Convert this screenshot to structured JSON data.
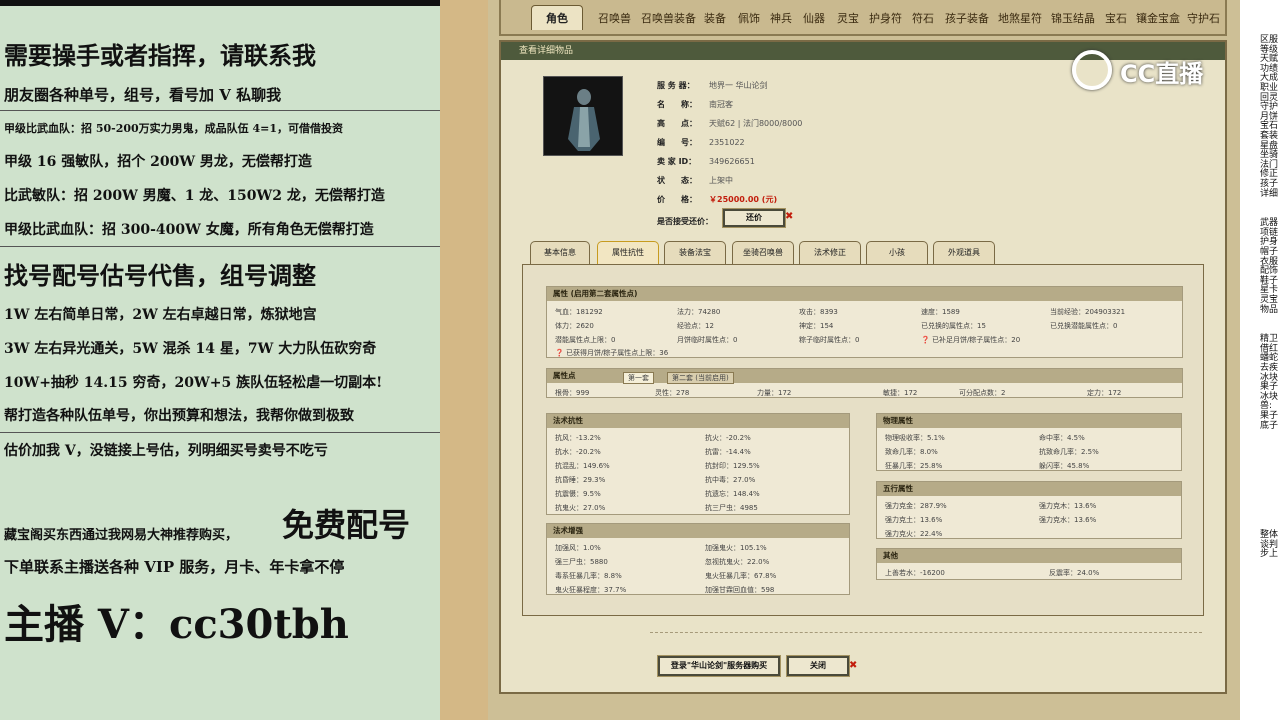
{
  "promo": {
    "l1": "需要操手或者指挥，请联系我",
    "l2": "朋友圈各种单号，组号，看号加 V 私聊我",
    "l3": "甲级比武血队：招 50-200万实力男鬼，成品队伍 4=1，可借借投资",
    "l4": "甲级 16 强敏队，招个 200W 男龙，无偿帮打造",
    "l5": "比武敏队：招 200W 男魔、1 龙、150W2 龙，无偿帮打造",
    "l6": "甲级比武血队：招 300-400W 女魔，所有角色无偿帮打造",
    "l7": "找号配号估号代售，组号调整",
    "l8": "1W 左右简单日常，2W 左右卓越日常，炼狱地宫",
    "l9": "3W 左右异光通关，5W 混杀 14 星，7W 大力队伍砍穷奇",
    "l10": "10W+抽秒 14.15 穷奇，20W+5 族队伍轻松虐一切副本!",
    "l11": "帮打造各种队伍单号，你出预算和想法，我帮你做到极致",
    "l12": "估价加我 V，没链接上号估，列明细买号卖号不吃亏",
    "l13a": "藏宝阁买东西通过我网易大神推荐购买，",
    "l13b": "免费配号",
    "l14": "下单联系主播送各种 VIP 服务，月卡、年卡拿不停",
    "l15": "主播 V：cc30tbh"
  },
  "tabs": [
    "角色",
    "召唤兽",
    "召唤兽装备",
    "装备",
    "佩饰",
    "神兵",
    "仙器",
    "灵宝",
    "护身符",
    "符石",
    "孩子装备",
    "地煞星符",
    "锦玉结晶",
    "宝石",
    "镶金宝盒",
    "守护石"
  ],
  "panel_title": "查看详细物品",
  "info": {
    "server_k": "服 务 器：",
    "server_v": "地界一 华山论剑",
    "name_k": "名　　称：",
    "name_v": "南冠客",
    "level_k": "高　　点：",
    "level_v": "天赋62 | 法门8000/8000",
    "id_k": "编　　号：",
    "id_v": "2351022",
    "seller_k": "卖 家 ID：",
    "seller_v": "349626651",
    "status_k": "状　　态：",
    "status_v": "上架中",
    "price_k": "价　　格：",
    "price_v": "￥25000.00 (元)",
    "bargain_k": "是否接受还价：",
    "bargain_btn": "还价"
  },
  "subtabs": [
    "基本信息",
    "属性抗性",
    "装备法宝",
    "坐骑召唤兽",
    "法术修正",
    "小孩",
    "外观道具"
  ],
  "attr": {
    "header": "属性 (启用第二套属性点)",
    "r1": [
      "气血：181292",
      "法力：74280",
      "攻击：8393",
      "速度：1589",
      "当前经验：204903321"
    ],
    "r2": [
      "体力：2620",
      "经验点：12",
      "神定：154",
      "已兑换的属性点：15",
      "已兑换潜能属性点：0"
    ],
    "r3": [
      "潜能属性点上限：0",
      "月饼临时属性点：0",
      "粽子临时属性点：0",
      "已补足月饼/粽子属性点：20"
    ],
    "r4": "已获得月饼/粽子属性点上限：36"
  },
  "points": {
    "header": "属性点",
    "tab1": "第一套",
    "tab2": "第二套 (当前启用)",
    "row": [
      "根骨：999",
      "灵性：278",
      "力量：172",
      "敏捷：172",
      "可分配点数：2",
      "定力：172"
    ]
  },
  "resist": {
    "header": "法术抗性",
    "items": [
      "抗风：-13.2%",
      "抗火：-20.2%",
      "抗水：-20.2%",
      "抗雷：-14.4%",
      "抗混乱：149.6%",
      "抗封印：129.5%",
      "抗昏睡：29.3%",
      "抗中毒：27.0%",
      "抗震慑：9.5%",
      "抗遗忘：148.4%",
      "抗鬼火：27.0%",
      "抗三尸虫：4985"
    ]
  },
  "boost": {
    "header": "法术增强",
    "items": [
      "加强风：1.0%",
      "加强鬼火：105.1%",
      "强三尸虫：5880",
      "忽视抗鬼火：22.0%",
      "毒系狂暴几率：8.8%",
      "鬼火狂暴几率：67.8%",
      "鬼火狂暴程度：37.7%",
      "加强甘霖回血值：598"
    ]
  },
  "phys": {
    "header": "物理属性",
    "items": [
      "物理吸收率：5.1%",
      "命中率：4.5%",
      "致命几率：8.0%",
      "抗致命几率：2.5%",
      "狂暴几率：25.8%",
      "躲闪率：45.8%"
    ]
  },
  "five": {
    "header": "五行属性",
    "items": [
      "强力克金：287.9%",
      "强力克木：13.6%",
      "强力克土：13.6%",
      "强力克水：13.6%",
      "强力克火：22.4%"
    ]
  },
  "other": {
    "header": "其他",
    "items": [
      "上善若水：-16200",
      "反震率：24.0%"
    ]
  },
  "buttons": {
    "login": "登录\"华山论剑\"服务器购买",
    "close": "关闭"
  },
  "logo": "CC直播",
  "right_labels": [
    "区服",
    "等级",
    "天赋",
    "功绩",
    "大成",
    "职业",
    "回灵",
    "守护",
    "月饼",
    "宝石",
    "套装",
    "星盘",
    "坐骑",
    "法门",
    "修正",
    "孩子",
    "详细",
    "武器",
    "项链",
    "护身",
    "帽子",
    "衣服",
    "配饰",
    "鞋子",
    "星卡",
    "灵宝",
    "物品",
    "精卫",
    "借红",
    "蟠蛇",
    "去疾",
    "冰块",
    "果子",
    "冰块",
    "兽:",
    "果子",
    "底子",
    "整体",
    "谈判",
    "步上"
  ],
  "colors": {
    "accent": "#c21d0c",
    "left_bg": "#cfe2cc",
    "panel_header": "#4e5a3c"
  }
}
